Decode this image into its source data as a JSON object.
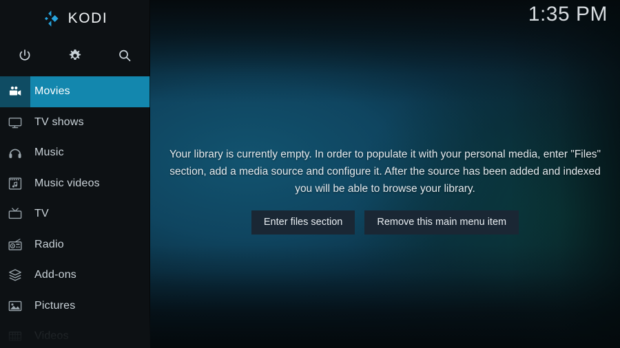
{
  "brand": {
    "name": "KODI",
    "logo_icon": "kodi-logo-icon",
    "logo_color": "#27a3dd"
  },
  "clock": {
    "time": "1:35 PM"
  },
  "toolbar": {
    "items": [
      {
        "name": "power-icon",
        "label": "Power"
      },
      {
        "name": "gear-icon",
        "label": "Settings"
      },
      {
        "name": "search-icon",
        "label": "Search"
      }
    ]
  },
  "sidebar": {
    "highlight_color": "#1387ae",
    "background_color": "#0d1114",
    "items": [
      {
        "label": "Movies",
        "icon": "movie-camera-icon",
        "active": true,
        "dim": false
      },
      {
        "label": "TV shows",
        "icon": "television-icon",
        "active": false,
        "dim": false
      },
      {
        "label": "Music",
        "icon": "headphones-icon",
        "active": false,
        "dim": false
      },
      {
        "label": "Music videos",
        "icon": "film-music-icon",
        "active": false,
        "dim": false
      },
      {
        "label": "TV",
        "icon": "retro-tv-icon",
        "active": false,
        "dim": false
      },
      {
        "label": "Radio",
        "icon": "radio-icon",
        "active": false,
        "dim": false
      },
      {
        "label": "Add-ons",
        "icon": "package-box-icon",
        "active": false,
        "dim": false
      },
      {
        "label": "Pictures",
        "icon": "picture-icon",
        "active": false,
        "dim": false
      },
      {
        "label": "Videos",
        "icon": "film-strip-icon",
        "active": false,
        "dim": true
      }
    ]
  },
  "main": {
    "empty_message": "Your library is currently empty. In order to populate it with your personal media, enter \"Files\" section, add a media source and configure it. After the source has been added and indexed you will be able to browse your library.",
    "buttons": [
      {
        "label": "Enter files section"
      },
      {
        "label": "Remove this main menu item"
      }
    ],
    "background_color": "#12536f"
  }
}
